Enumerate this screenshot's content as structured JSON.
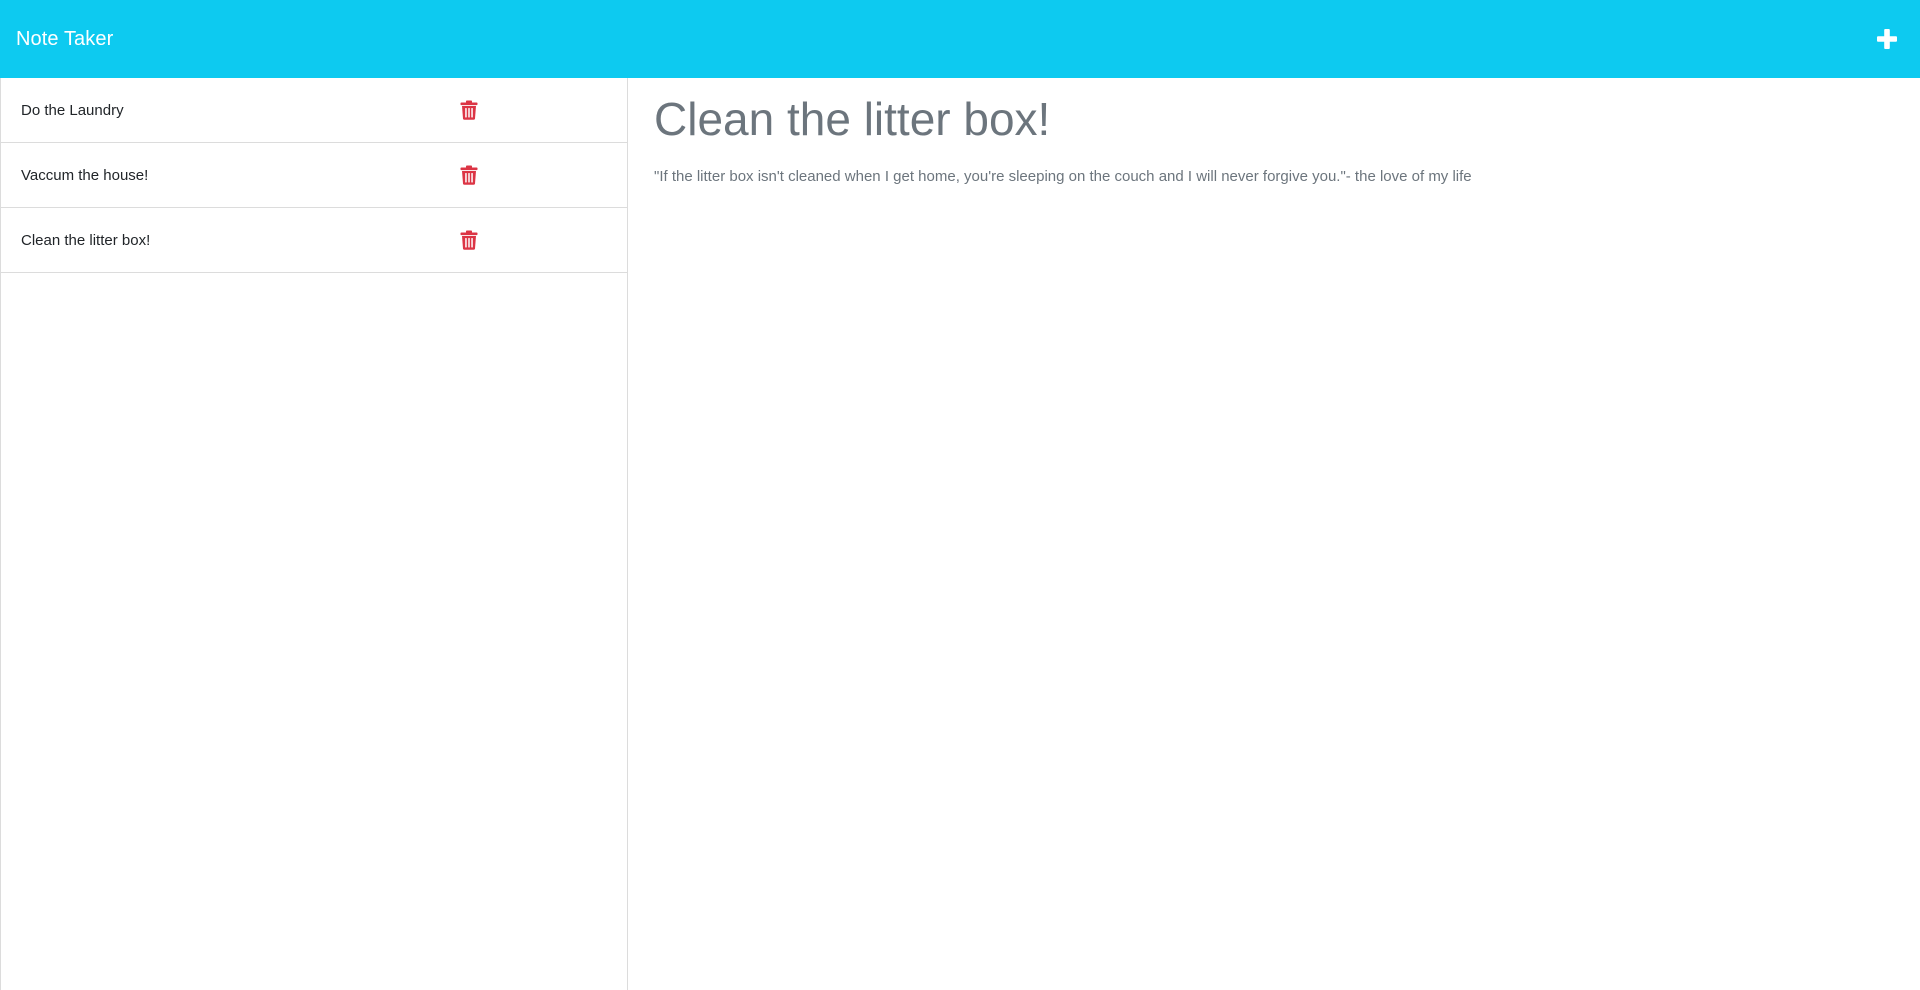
{
  "app": {
    "brand": "Note Taker",
    "accent_color": "#0dcaf0",
    "new_note_icon": "plus-icon"
  },
  "notes": [
    {
      "title": "Do the Laundry",
      "delete_icon": "trash-icon",
      "delete_color": "#dc3545"
    },
    {
      "title": "Vaccum the house!",
      "delete_icon": "trash-icon",
      "delete_color": "#dc3545"
    },
    {
      "title": "Clean the litter box!",
      "delete_icon": "trash-icon",
      "delete_color": "#dc3545"
    }
  ],
  "active_note": {
    "title": "Clean the litter box!",
    "text": "\"If the litter box isn't cleaned when I get home, you're sleeping on the couch and I will never forgive you.\"- the love of my life"
  }
}
